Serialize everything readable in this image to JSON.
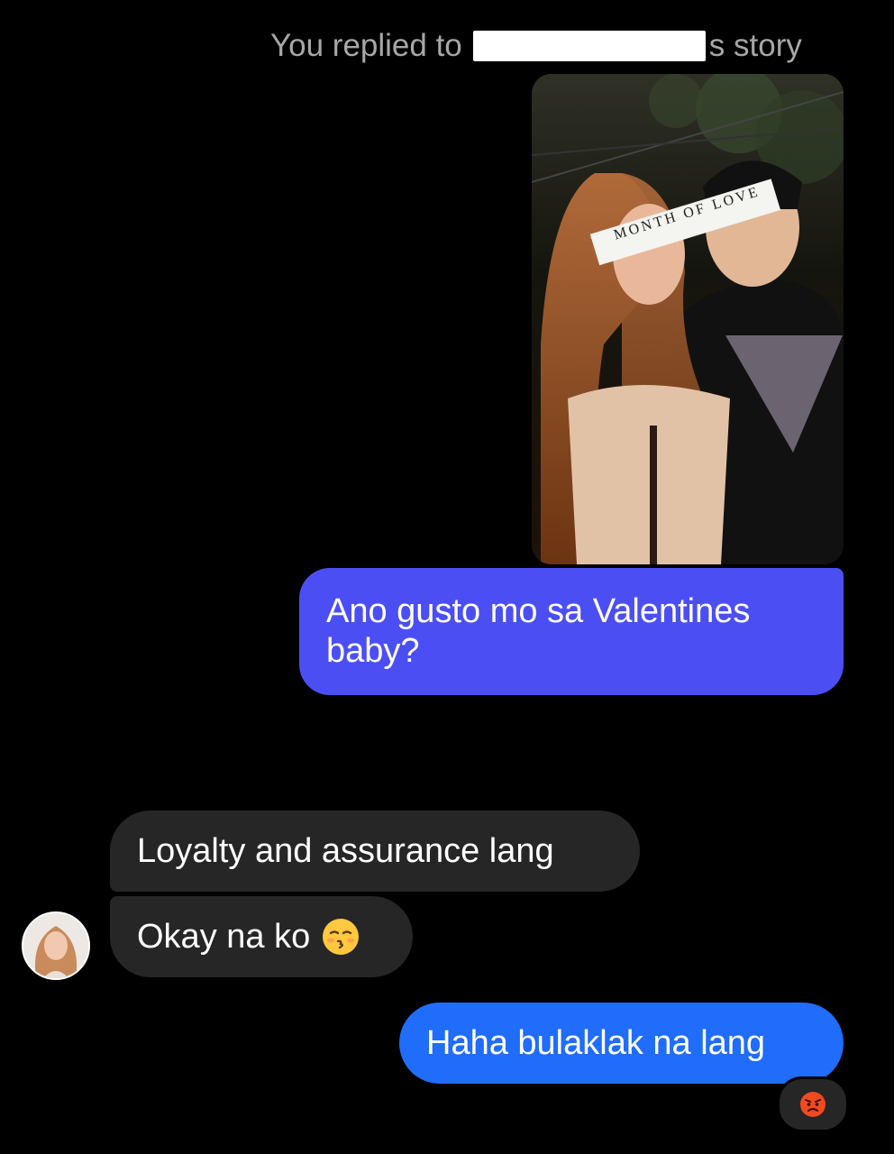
{
  "story_reply": {
    "prefix": "You replied to",
    "suffix": "s story"
  },
  "story_thumbnail": {
    "overlay_text": "MONTH OF LOVE"
  },
  "messages": [
    {
      "sender": "me",
      "text": "Ano gusto mo sa Valentines baby?"
    },
    {
      "sender": "them",
      "text": "Loyalty and assurance lang"
    },
    {
      "sender": "them",
      "text": "Okay na ko",
      "emoji": "kissing-face-icon"
    },
    {
      "sender": "me",
      "text": "Haha bulaklak na lang",
      "reaction": "angry-face-icon"
    }
  ],
  "colors": {
    "outgoing_primary": "#4b4ff3",
    "outgoing_secondary": "#1f6dfa",
    "incoming": "#262626",
    "background": "#000000"
  }
}
